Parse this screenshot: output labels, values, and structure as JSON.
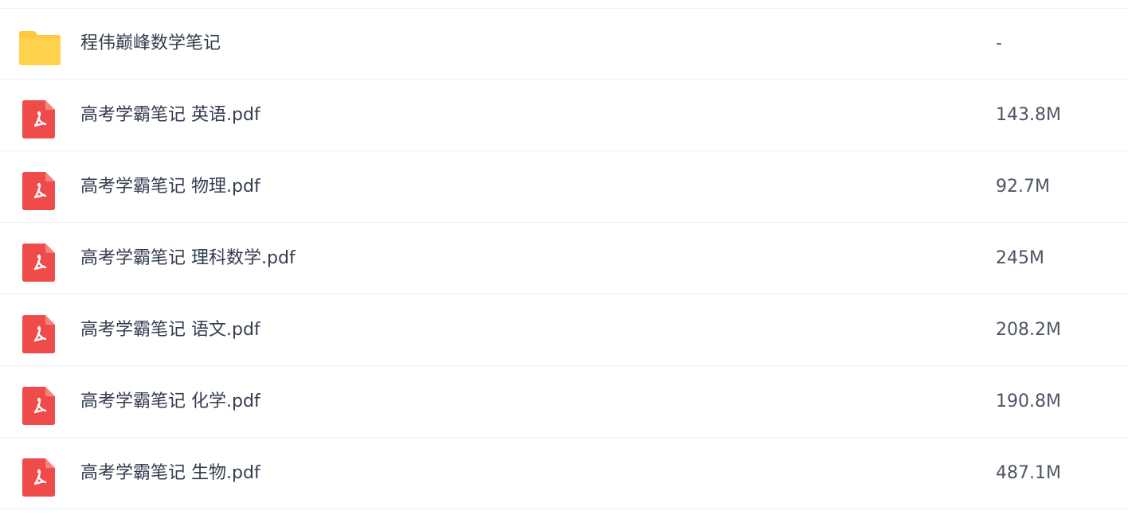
{
  "files": [
    {
      "name": "程伟巅峰数学笔记",
      "size": "-",
      "type": "folder",
      "icon": "folder-icon"
    },
    {
      "name": "高考学霸笔记 英语.pdf",
      "size": "143.8M",
      "type": "pdf",
      "icon": "pdf-icon"
    },
    {
      "name": "高考学霸笔记 物理.pdf",
      "size": "92.7M",
      "type": "pdf",
      "icon": "pdf-icon"
    },
    {
      "name": "高考学霸笔记 理科数学.pdf",
      "size": "245M",
      "type": "pdf",
      "icon": "pdf-icon"
    },
    {
      "name": "高考学霸笔记 语文.pdf",
      "size": "208.2M",
      "type": "pdf",
      "icon": "pdf-icon"
    },
    {
      "name": "高考学霸笔记 化学.pdf",
      "size": "190.8M",
      "type": "pdf",
      "icon": "pdf-icon"
    },
    {
      "name": "高考学霸笔记 生物.pdf",
      "size": "487.1M",
      "type": "pdf",
      "icon": "pdf-icon"
    }
  ],
  "colors": {
    "folder": "#ffd24d",
    "pdf": "#f04b4b",
    "text": "#333d4d",
    "size_text": "#4d5563",
    "divider": "#edf0f5"
  }
}
